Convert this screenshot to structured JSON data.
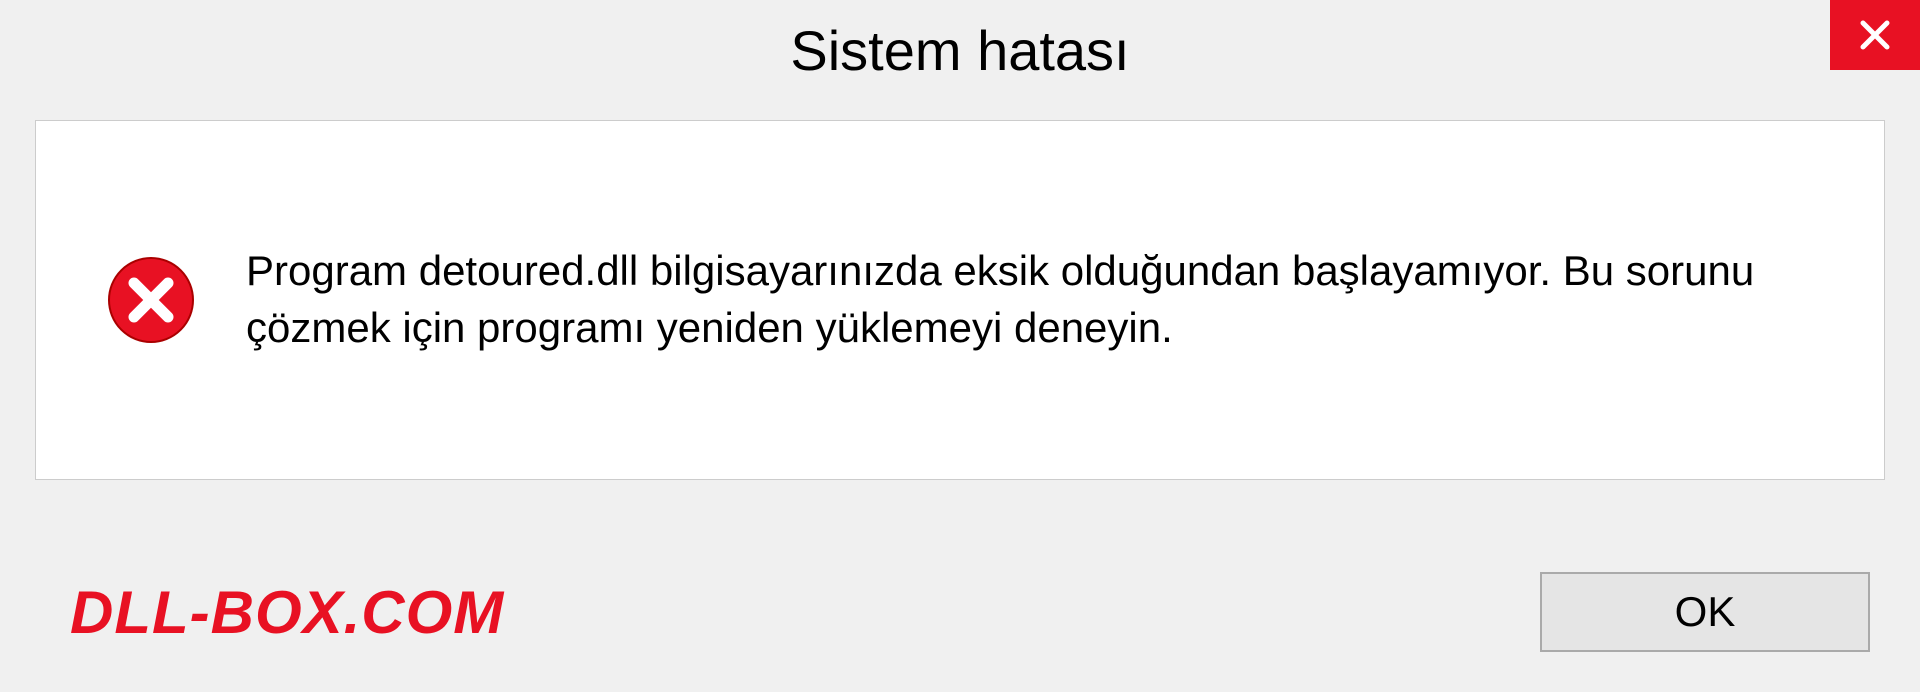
{
  "dialog": {
    "title": "Sistem hatası",
    "message": "Program detoured.dll bilgisayarınızda eksik olduğundan başlayamıyor. Bu sorunu çözmek için programı yeniden yüklemeyi deneyin.",
    "ok_label": "OK"
  },
  "watermark": "DLL-BOX.COM"
}
